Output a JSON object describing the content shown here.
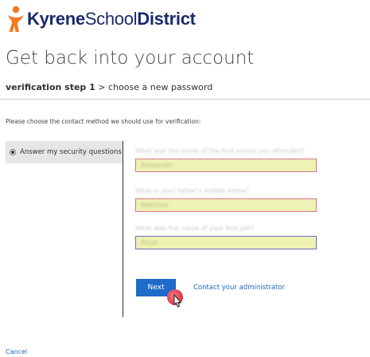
{
  "brand": {
    "name_part1": "Kyrene",
    "name_part2": "School",
    "name_part3": "District",
    "colors": {
      "mark": "#f47a20",
      "text": "#1b2a6b"
    }
  },
  "page": {
    "title": "Get back into your account"
  },
  "steps": {
    "current": "verification step 1",
    "separator": " > ",
    "next": "choose a new password"
  },
  "instruction": "Please choose the contact method we should use for verification:",
  "method": {
    "label": "Answer my security questions",
    "selected": true
  },
  "questions": [
    {
      "label": "What was the name of the first school you attended?",
      "answer": "Alexander"
    },
    {
      "label": "What is your father's middle name?",
      "answer": "Matthew"
    },
    {
      "label": "What was the name of your first pet?",
      "answer": "Rhod"
    }
  ],
  "actions": {
    "next_label": "Next",
    "contact_label": "Contact your administrator",
    "cancel_label": "Cancel"
  },
  "colors": {
    "accent": "#1e6bc9",
    "link": "#1e66c4",
    "field_bg": "#eef2b2",
    "field_border": "#d8758f",
    "field_focus": "#6f6cc4"
  }
}
